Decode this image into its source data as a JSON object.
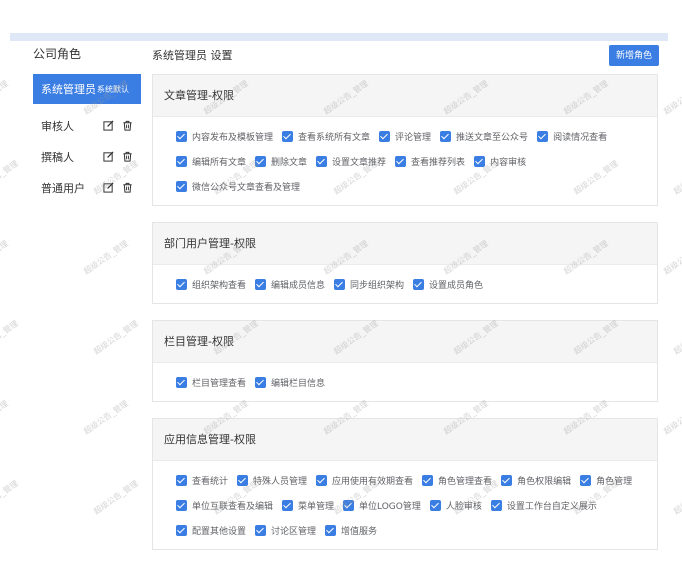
{
  "sidebar": {
    "title": "公司角色",
    "roles": [
      {
        "name": "系统管理员",
        "tag": "系统默认",
        "active": true
      },
      {
        "name": "审核人"
      },
      {
        "name": "撰稿人"
      },
      {
        "name": "普通用户"
      }
    ]
  },
  "main": {
    "title": "系统管理员 设置",
    "add_button": "新增角色",
    "panels": [
      {
        "title": "文章管理-权限",
        "perms": [
          "内容发布及模板管理",
          "查看系统所有文章",
          "评论管理",
          "推送文章至公众号",
          "阅读情况查看",
          "编辑所有文章",
          "删除文章",
          "设置文章推荐",
          "查看推荐列表",
          "内容审核",
          "微信公众号文章查看及管理"
        ]
      },
      {
        "title": "部门用户管理-权限",
        "perms": [
          "组织架构查看",
          "编辑成员信息",
          "同步组织架构",
          "设置成员角色"
        ]
      },
      {
        "title": "栏目管理-权限",
        "perms": [
          "栏目管理查看",
          "编辑栏目信息"
        ]
      },
      {
        "title": "应用信息管理-权限",
        "perms": [
          "查看统计",
          "特殊人员管理",
          "应用使用有效期查看",
          "角色管理查看",
          "角色权限编辑",
          "角色管理",
          "单位互联查看及编辑",
          "菜单管理",
          "单位LOGO管理",
          "人脸审核",
          "设置工作台自定义展示",
          "配置其他设置",
          "讨论区管理",
          "增值服务"
        ]
      }
    ]
  },
  "watermark": "超级公告_管理"
}
